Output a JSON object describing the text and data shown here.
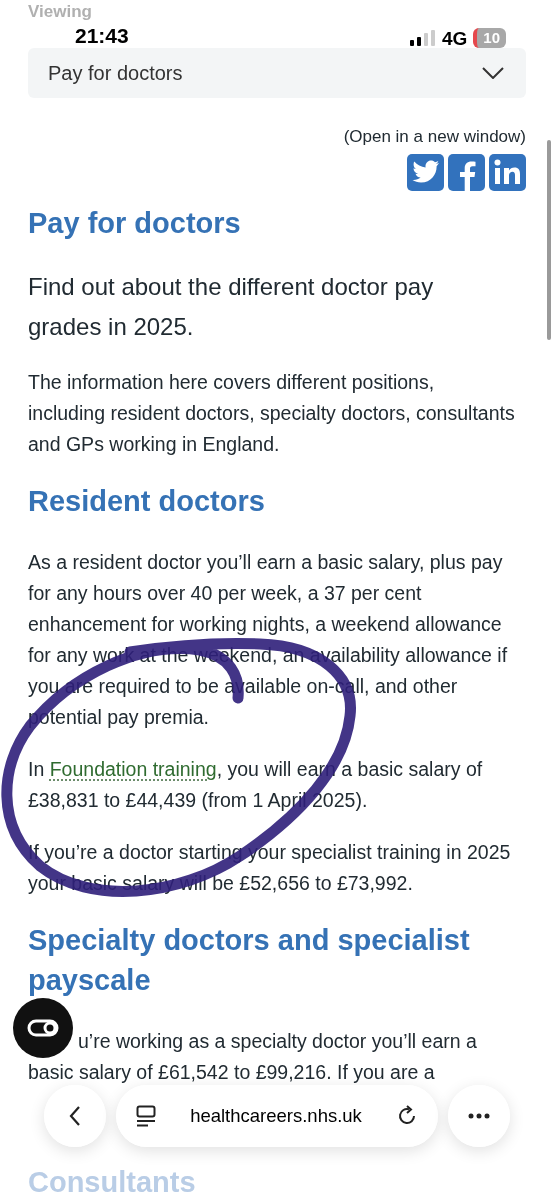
{
  "status_bar": {
    "overlay_label": "Viewing",
    "time": "21:43",
    "network": "4G",
    "battery": "10"
  },
  "page_selector": {
    "value": "Pay for doctors"
  },
  "share": {
    "label": "(Open in a new window)"
  },
  "article": [
    {
      "kind": "h1",
      "text": "Pay for doctors"
    },
    {
      "kind": "lead",
      "text": "Find out about the different doctor pay grades in 2025."
    },
    {
      "kind": "p",
      "text": "The information here covers different positions, including resident doctors, specialty doctors, consultants and GPs working in England."
    },
    {
      "kind": "h2",
      "text": "Resident doctors"
    },
    {
      "kind": "p",
      "text": "As a resident doctor you’ll earn a basic salary, plus pay for any hours over 40 per week, a 37 per cent enhancement for working nights, a weekend allowance for any work at the weekend, an availability allowance if you are required to be available on-call, and other potential pay premia."
    },
    {
      "kind": "link_p",
      "before": "In ",
      "link": "Foundation training",
      "after": ", you will earn a basic salary of £38,831 to £44,439 (from 1 April 2025)."
    },
    {
      "kind": "p",
      "text": "If you’re a doctor starting your specialist training in 2025 your basic salary will be £52,656 to £73,992."
    },
    {
      "kind": "h2",
      "text": "Specialty doctors and specialist payscale"
    },
    {
      "kind": "split_p",
      "lines": [
        "u’re working as a specialty doctor you’ll earn a",
        "basic salary of £61,542 to £99,216. If you are a"
      ]
    },
    {
      "kind": "faded_h2",
      "text": "Consultants"
    }
  ],
  "browser_bar": {
    "url": "healthcareers.nhs.uk"
  }
}
